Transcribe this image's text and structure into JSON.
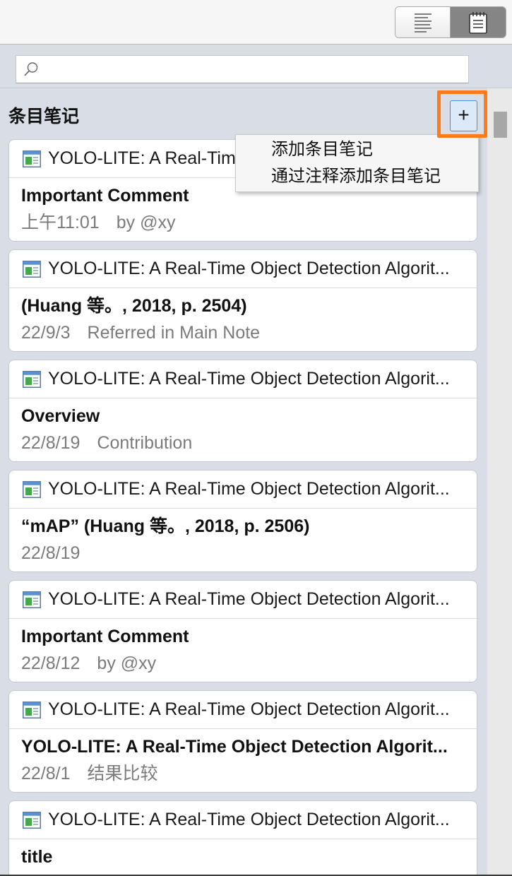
{
  "toolbar": {
    "view_switch": [
      {
        "icon": "text-lines-icon",
        "selected": false
      },
      {
        "icon": "notepad-icon",
        "selected": true
      }
    ]
  },
  "search": {
    "value": "",
    "icon": "search-icon"
  },
  "section": {
    "title": "条目笔记",
    "add_button": "+"
  },
  "add_menu": {
    "items": [
      "添加条目笔记",
      "通过注释添加条目笔记"
    ]
  },
  "notes": [
    {
      "parent_title": "YOLO-LITE: A Real-Time Object Detection Algorit...",
      "icon": "webpage-item-icon",
      "title": "Important Comment",
      "date": "上午11:01",
      "meta": "by @xy"
    },
    {
      "parent_title": "YOLO-LITE: A Real-Time Object Detection Algorit...",
      "icon": "webpage-item-icon",
      "title": "(Huang 等。, 2018, p. 2504)",
      "date": "22/9/3",
      "meta": "Referred in Main Note"
    },
    {
      "parent_title": "YOLO-LITE: A Real-Time Object Detection Algorit...",
      "icon": "webpage-item-icon",
      "title": "Overview",
      "date": "22/8/19",
      "meta": "Contribution"
    },
    {
      "parent_title": "YOLO-LITE: A Real-Time Object Detection Algorit...",
      "icon": "webpage-item-icon",
      "title": "“mAP” (Huang 等。, 2018, p. 2506)",
      "date": "22/8/19"
    },
    {
      "parent_title": "YOLO-LITE: A Real-Time Object Detection Algorit...",
      "icon": "webpage-item-icon",
      "title": "Important Comment",
      "date": "22/8/12",
      "meta": "by @xy"
    },
    {
      "parent_title": "YOLO-LITE: A Real-Time Object Detection Algorit...",
      "icon": "webpage-item-icon",
      "title": "YOLO-LITE: A Real-Time Object Detection Algorit...",
      "date": "22/8/1",
      "meta": "结果比较"
    },
    {
      "parent_title": "YOLO-LITE: A Real-Time Object Detection Algorit...",
      "icon": "webpage-item-icon",
      "title": "title"
    }
  ],
  "colors": {
    "highlight_frame": "#ff7a1a",
    "add_button_border": "#4f8ad6",
    "add_button_fill": "#dce9f8",
    "selected_segment": "#858585",
    "panel_background": "#d9dee6"
  }
}
